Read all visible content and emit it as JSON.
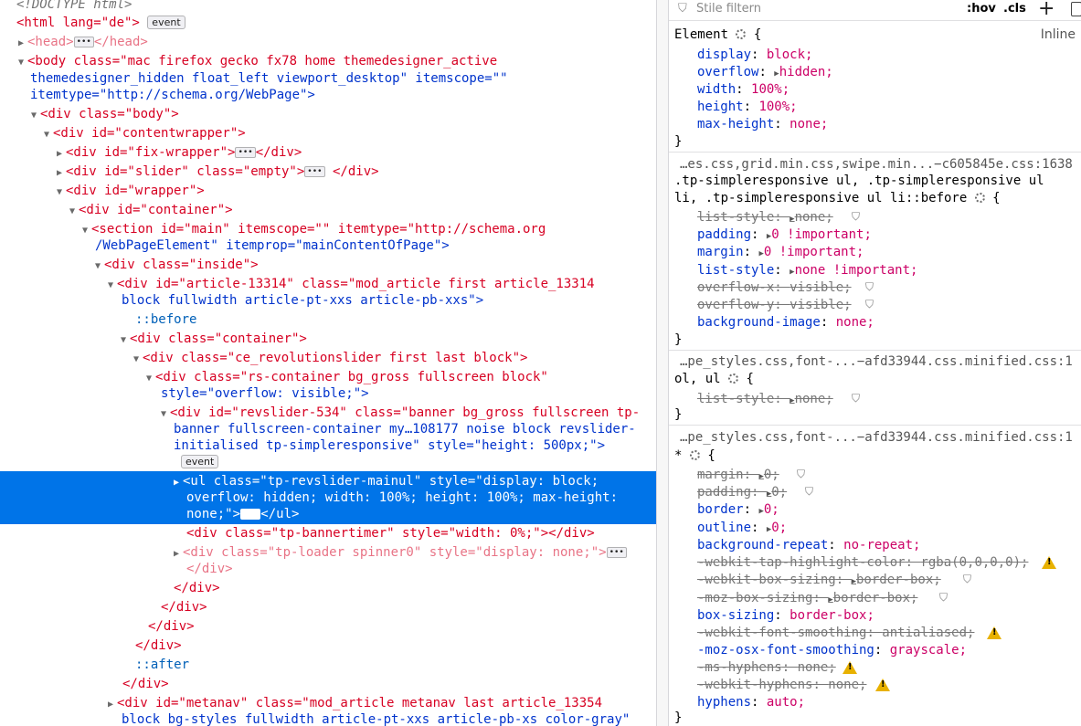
{
  "markup": {
    "doctype": "<!DOCTYPE html>",
    "html_open": "<html lang=\"de\">",
    "event_badge": "event",
    "head": "<head>",
    "head_close": "</head>",
    "body_l1": "<body class=\"mac firefox gecko fx78 home themedesigner_active",
    "body_l2": "themedesigner_hidden float_left viewport_desktop\" itemscope=\"\"",
    "body_l3": "itemtype=\"http://schema.org/WebPage\">",
    "div_body": "<div class=\"body\">",
    "div_contentwrapper": "<div id=\"contentwrapper\">",
    "div_fixwrapper": "<div id=\"fix-wrapper\">",
    "div_close": "</div>",
    "div_slider": "<div id=\"slider\" class=\"empty\">",
    "div_wrapper": "<div id=\"wrapper\">",
    "div_container": "<div id=\"container\">",
    "section_l1": "<section id=\"main\" itemscope=\"\" itemtype=\"http://schema.org",
    "section_l2": "/WebPageElement\" itemprop=\"mainContentOfPage\">",
    "div_inside": "<div class=\"inside\">",
    "article_l1": "<div id=\"article-13314\" class=\"mod_article first article_13314",
    "article_l2": "block fullwidth article-pt-xxs article-pb-xxs\">",
    "before": "::before",
    "div_container2": "<div class=\"container\">",
    "revslider_ce": "<div class=\"ce_revolutionslider first last block\">",
    "rs_l1": "<div class=\"rs-container bg_gross fullscreen block\"",
    "rs_l2": "style=\"overflow: visible;\">",
    "rev_l1": "<div id=\"revslider-534\" class=\"banner bg_gross fullscreen tp-",
    "rev_l2": "banner fullscreen-container my…108177 noise block revslider-",
    "rev_l3": "initialised tp-simpleresponsive\" style=\"height: 500px;\">",
    "ul_l1": "<ul class=\"tp-revslider-mainul\" style=\"display: block;",
    "ul_l2": "overflow: hidden; width: 100%; height: 100%; max-height:",
    "ul_l3": "none;\">",
    "ul_close": "</ul>",
    "bannertimer": "<div class=\"tp-bannertimer\" style=\"width: 0%;\"></div>",
    "loader": "<div class=\"tp-loader spinner0\" style=\"display: none;\">",
    "after": "::after",
    "metanav_l1": "<div id=\"metanav\" class=\"mod_article metanav last article_13354",
    "metanav_l2": "block bg-styles fullwidth article-pt-xxs article-pb-xs color-gray\""
  },
  "rules": {
    "filter_placeholder": "Stile filtern",
    "hov": ":hov",
    "cls": ".cls",
    "element_selector": "Element",
    "inline": "Inline",
    "brace_open": "{",
    "brace_close": "}",
    "el_props": [
      {
        "name": "display",
        "value": "block;"
      },
      {
        "name": "overflow",
        "value": "hidden;"
      },
      {
        "name": "width",
        "value": "100%;"
      },
      {
        "name": "height",
        "value": "100%;"
      },
      {
        "name": "max-height",
        "value": "none;"
      }
    ],
    "src1": "…es.css,grid.min.css,swipe.min...−c605845e.css:1638",
    "sel1_l1": ".tp-simpleresponsive ul, .tp-simpleresponsive ul",
    "sel1_l2": "li, .tp-simpleresponsive ul li::before",
    "r1_props": [
      {
        "name": "list-style",
        "value": "none;",
        "strike": true
      },
      {
        "name": "padding",
        "value": "0 !important;"
      },
      {
        "name": "margin",
        "value": "0 !important;"
      },
      {
        "name": "list-style",
        "value": "none !important;"
      },
      {
        "name": "overflow-x",
        "value": "visible;",
        "strike": true
      },
      {
        "name": "overflow-y",
        "value": "visible;",
        "strike": true
      },
      {
        "name": "background-image",
        "value": "none;"
      }
    ],
    "src2": "…pe_styles.css,font-...−afd33944.css.minified.css:1",
    "sel2": "ol, ul",
    "r2_prop": {
      "name": "list-style",
      "value": "none;"
    },
    "src3": "…pe_styles.css,font-...−afd33944.css.minified.css:1",
    "sel3": "*",
    "r3_props": [
      {
        "name": "margin",
        "value": "0;"
      },
      {
        "name": "padding",
        "value": "0;"
      },
      {
        "name": "border",
        "value": "0;"
      },
      {
        "name": "outline",
        "value": "0;"
      },
      {
        "name": "background-repeat",
        "value": "no-repeat;"
      },
      {
        "name": "-webkit-tap-highlight-color",
        "value": "rgba(0,0,0,0);"
      },
      {
        "name": "-webkit-box-sizing",
        "value": "border-box;"
      },
      {
        "name": "-moz-box-sizing",
        "value": "border-box;"
      },
      {
        "name": "box-sizing",
        "value": "border-box;"
      },
      {
        "name": "-webkit-font-smoothing",
        "value": "antialiased;"
      },
      {
        "name": "-moz-osx-font-smoothing",
        "value": "grayscale;"
      },
      {
        "name": "-ms-hyphens",
        "value": "none;"
      },
      {
        "name": "-webkit-hyphens",
        "value": "none;"
      },
      {
        "name": "hyphens",
        "value": "auto;"
      }
    ]
  }
}
